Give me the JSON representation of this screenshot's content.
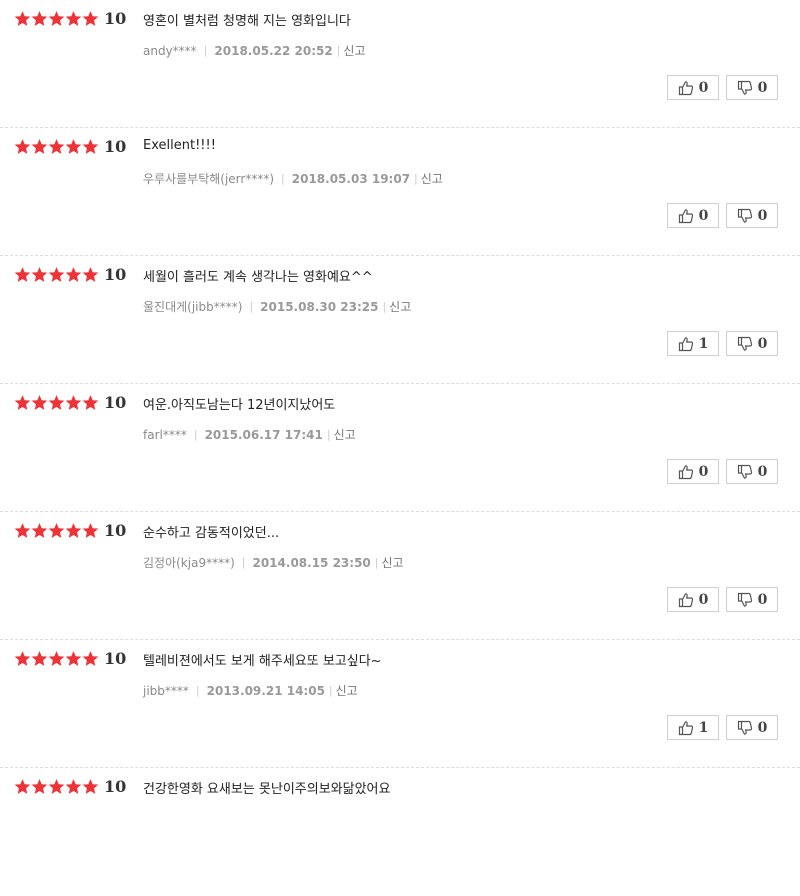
{
  "reviews": [
    {
      "score": "10",
      "comment": "영혼이 별처럼 청명해 지는 영화입니다",
      "author": "andy****",
      "date": "2018.05.22 20:52",
      "report": "신고",
      "like": "0",
      "dislike": "0"
    },
    {
      "score": "10",
      "comment": "Exellent!!!!",
      "author": "우루사를부탁해(jerr****)",
      "date": "2018.05.03 19:07",
      "report": "신고",
      "like": "0",
      "dislike": "0"
    },
    {
      "score": "10",
      "comment": "세월이 흘러도 계속 생각나는 영화예요^^",
      "author": "울진대게(jibb****)",
      "date": "2015.08.30 23:25",
      "report": "신고",
      "like": "1",
      "dislike": "0"
    },
    {
      "score": "10",
      "comment": "여운.아직도남는다 12년이지났어도",
      "author": "farl****",
      "date": "2015.06.17 17:41",
      "report": "신고",
      "like": "0",
      "dislike": "0"
    },
    {
      "score": "10",
      "comment": "순수하고 감동적이었던...",
      "author": "김정아(kja9****)",
      "date": "2014.08.15 23:50",
      "report": "신고",
      "like": "0",
      "dislike": "0"
    },
    {
      "score": "10",
      "comment": "텔레비젼에서도 보게 해주세요또 보고싶다~",
      "author": "jibb****",
      "date": "2013.09.21 14:05",
      "report": "신고",
      "like": "1",
      "dislike": "0"
    },
    {
      "score": "10",
      "comment": "건강한영화 요새보는 못난이주의보와닮았어요",
      "author": "",
      "date": "",
      "report": "",
      "like": "",
      "dislike": ""
    }
  ],
  "rating": {
    "stars_filled": 5,
    "stars_total": 5
  },
  "colors": {
    "star": "#ee3338",
    "divider": "#dddddd"
  },
  "icons": {
    "star": "star-icon",
    "like": "thumbs-up-icon",
    "dislike": "thumbs-down-icon"
  }
}
